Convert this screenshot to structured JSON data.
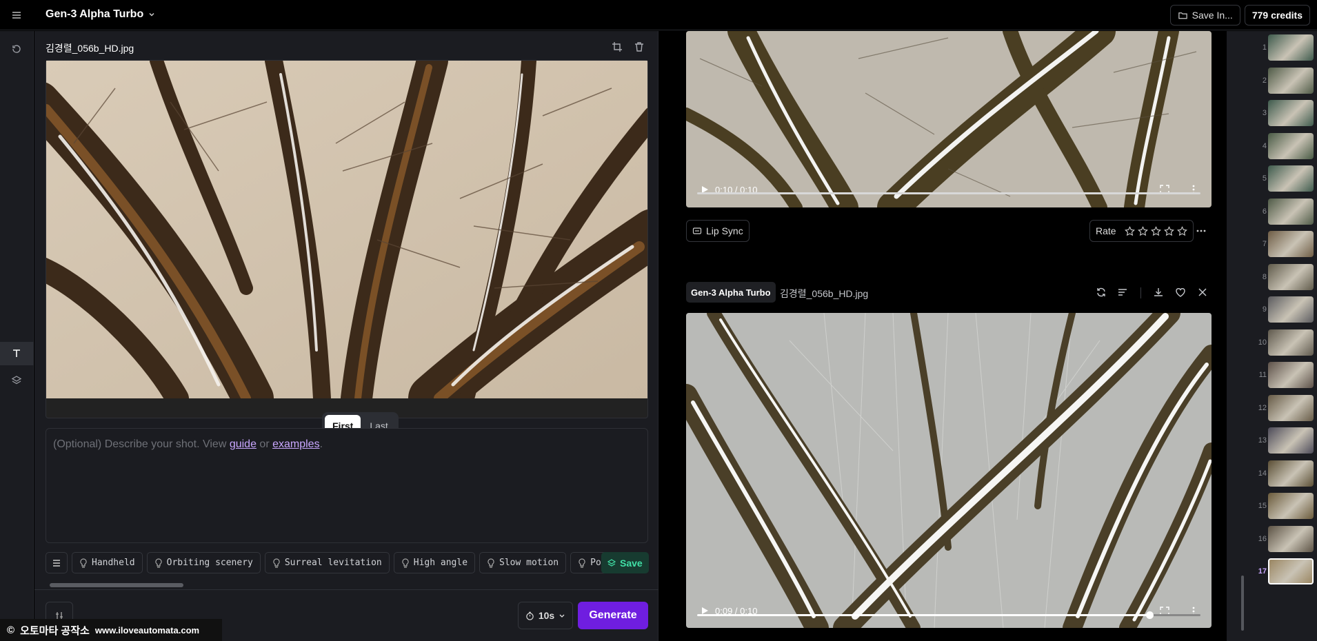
{
  "header": {
    "menu_icon": "menu-icon",
    "app_title": "Gen-3 Alpha Turbo",
    "save_in_label": "Save In...",
    "credits": "779 credits"
  },
  "rail": {
    "icons": [
      "history-icon",
      "text-icon",
      "layers-icon"
    ]
  },
  "editor": {
    "file_name": "김경렬_056b_HD.jpg",
    "frame_toggle": {
      "first": "First",
      "last": "Last",
      "selected": "First"
    },
    "prompt": {
      "placeholder_before": "(Optional) Describe your shot. View ",
      "guide_link": "guide",
      "or_text": " or ",
      "examples_link": "examples",
      "period": "."
    },
    "presets": [
      "Handheld",
      "Orbiting scenery",
      "Surreal levitation",
      "High angle",
      "Slow motion",
      "Port"
    ],
    "save_label": "Save",
    "duration": "10s",
    "generate_label": "Generate"
  },
  "feed": {
    "video1": {
      "time": "0:10 / 0:10",
      "progress": 1.0
    },
    "lip_sync_label": "Lip Sync",
    "rate_label": "Rate",
    "card2": {
      "model_tag": "Gen-3 Alpha Turbo",
      "file_name": "김경렬_056b_HD.jpg",
      "time": "0:09 / 0:10",
      "progress": 0.9
    }
  },
  "thumbnails": [
    "1",
    "2",
    "3",
    "4",
    "5",
    "6",
    "7",
    "8",
    "9",
    "10",
    "11",
    "12",
    "13",
    "14",
    "15",
    "16",
    "17"
  ],
  "active_thumbnail": "17",
  "watermark": {
    "copyright": "©",
    "name": "오토마타 공작소",
    "url": "www.iloveautomata.com"
  },
  "colors": {
    "accent": "#6f1ee0",
    "save_green": "#41e0a6",
    "link": "#c9a7ff"
  }
}
